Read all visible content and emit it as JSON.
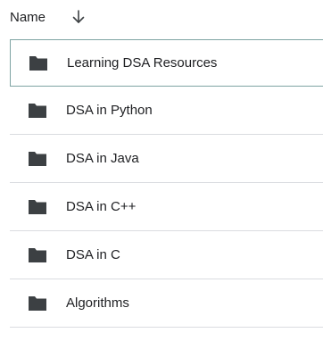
{
  "header": {
    "name_label": "Name",
    "sort_icon": "arrow-down-icon"
  },
  "rows": [
    {
      "label": "Learning DSA Resources",
      "icon": "folder-icon",
      "selected": true
    },
    {
      "label": "DSA in Python",
      "icon": "folder-icon",
      "selected": false
    },
    {
      "label": "DSA in Java",
      "icon": "folder-icon",
      "selected": false
    },
    {
      "label": "DSA in C++",
      "icon": "folder-icon",
      "selected": false
    },
    {
      "label": "DSA in C",
      "icon": "folder-icon",
      "selected": false
    },
    {
      "label": "Algorithms",
      "icon": "folder-icon",
      "selected": false
    }
  ],
  "colors": {
    "folder": "#3c4043",
    "divider": "#dadce0",
    "selected_border": "#7fa4a3",
    "text": "#202124"
  }
}
